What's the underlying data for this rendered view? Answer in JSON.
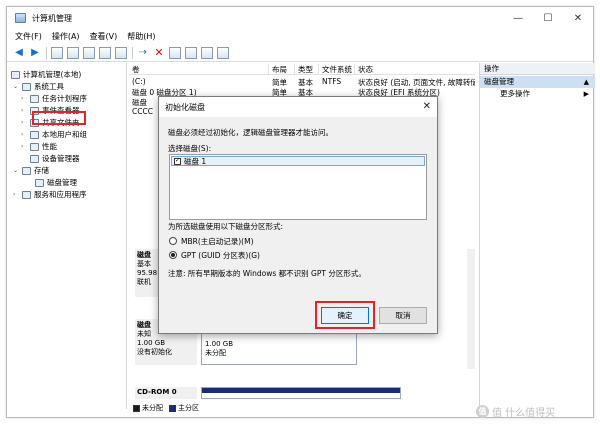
{
  "window": {
    "title": "计算机管理",
    "controls": [
      "—",
      "☐",
      "✕"
    ]
  },
  "menu": [
    "文件(F)",
    "操作(A)",
    "查看(V)",
    "帮助(H)"
  ],
  "tree": {
    "root": "计算机管理(本地)",
    "system_tools": "系统工具",
    "task_scheduler": "任务计划程序",
    "event_viewer": "事件查看器",
    "shared_folders": "共享文件夹",
    "local_users": "本地用户和组",
    "performance": "性能",
    "device_manager": "设备管理器",
    "storage": "存储",
    "disk_management": "磁盘管理",
    "services_apps": "服务和应用程序"
  },
  "volume_list": {
    "headers": [
      "卷",
      "布局",
      "类型",
      "文件系统",
      "状态"
    ],
    "rows": [
      [
        "(C:)",
        "简单",
        "基本",
        "NTFS",
        "状态良好 (启动, 页面文件, 故障转储, 基本"
      ],
      [
        "磁盘 0 磁盘分区 1)",
        "简单",
        "基本",
        "",
        "状态良好 (EFI 系统分区)"
      ],
      [
        "磁盘",
        "",
        "",
        "",
        ""
      ],
      [
        "CCCC",
        "",
        "",
        "",
        ""
      ]
    ]
  },
  "actions": {
    "header": "操作",
    "section": "磁盘管理",
    "more": "更多操作"
  },
  "disks": [
    {
      "title": "磁盘",
      "lines": [
        "基本",
        "95.98 G",
        "联机"
      ]
    },
    {
      "title": "磁盘",
      "lines": [
        "未知",
        "1.00 GB",
        "没有初始化"
      ],
      "part_size": "1.00 GB",
      "part_status": "未分配"
    },
    {
      "title": "CD-ROM 0",
      "lines": []
    }
  ],
  "legend": [
    "未分配",
    "主分区"
  ],
  "dialog": {
    "title": "初始化磁盘",
    "intro": "磁盘必须经过初始化，逻辑磁盘管理器才能访问。",
    "select_label": "选择磁盘(S):",
    "disk_item": "磁盘 1",
    "style_label": "为所选磁盘使用以下磁盘分区形式:",
    "mbr": "MBR(主启动记录)(M)",
    "gpt": "GPT (GUID 分区表)(G)",
    "note": "注意: 所有早期版本的 Windows 都不识别 GPT 分区形式。",
    "ok": "确定",
    "cancel": "取消"
  },
  "watermark": "值 什么值得买"
}
